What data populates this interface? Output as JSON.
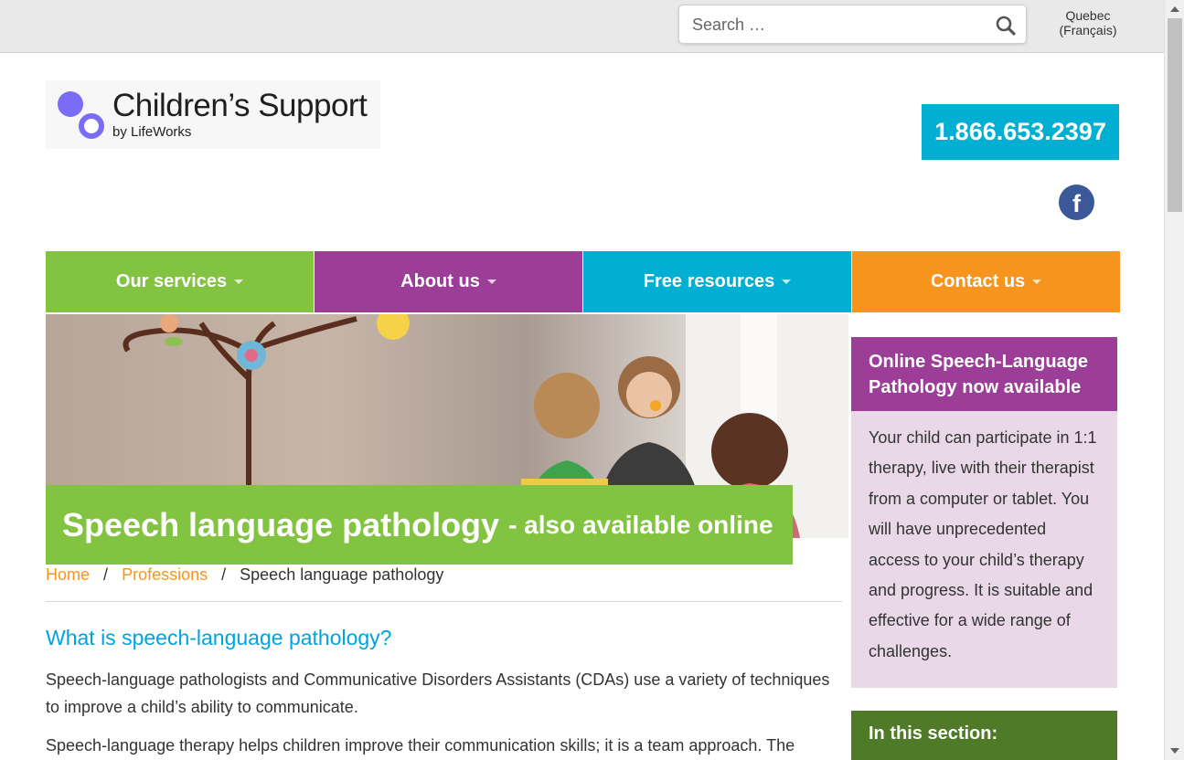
{
  "topbar": {
    "search_placeholder": "Search …",
    "lang_line1": "Quebec",
    "lang_line2": "(Français)"
  },
  "header": {
    "logo_name": "Children’s Support",
    "logo_by": "by LifeWorks",
    "phone": "1.866.653.2397",
    "facebook_glyph": "f"
  },
  "nav": {
    "items": [
      {
        "label": "Our services",
        "color": "#82c341"
      },
      {
        "label": "About us",
        "color": "#9c3d97"
      },
      {
        "label": "Free resources",
        "color": "#00afd2"
      },
      {
        "label": "Contact us",
        "color": "#f7941d"
      }
    ]
  },
  "hero": {
    "title": "Speech language pathology",
    "subtitle": "- also available online"
  },
  "breadcrumb": {
    "home": "Home",
    "professions": "Professions",
    "sep": "/",
    "current": "Speech language pathology"
  },
  "main": {
    "heading": "What is speech-language pathology?",
    "para1": "Speech-language pathologists and Communicative Disorders Assistants (CDAs) use a variety of techniques to improve a child’s ability to communicate.",
    "para2": "Speech-language therapy helps children improve their communication skills; it is a team approach. The"
  },
  "sidebar": {
    "promo_title": "Online Speech-Language Pathology now available",
    "promo_body": "Your child can participate in 1:1 therapy, live with their therapist from a computer or tablet. You will have unprecedented access to your child’s therapy and progress. It is suitable and effective for a wide range of challenges.",
    "section_title": "In this section:"
  }
}
